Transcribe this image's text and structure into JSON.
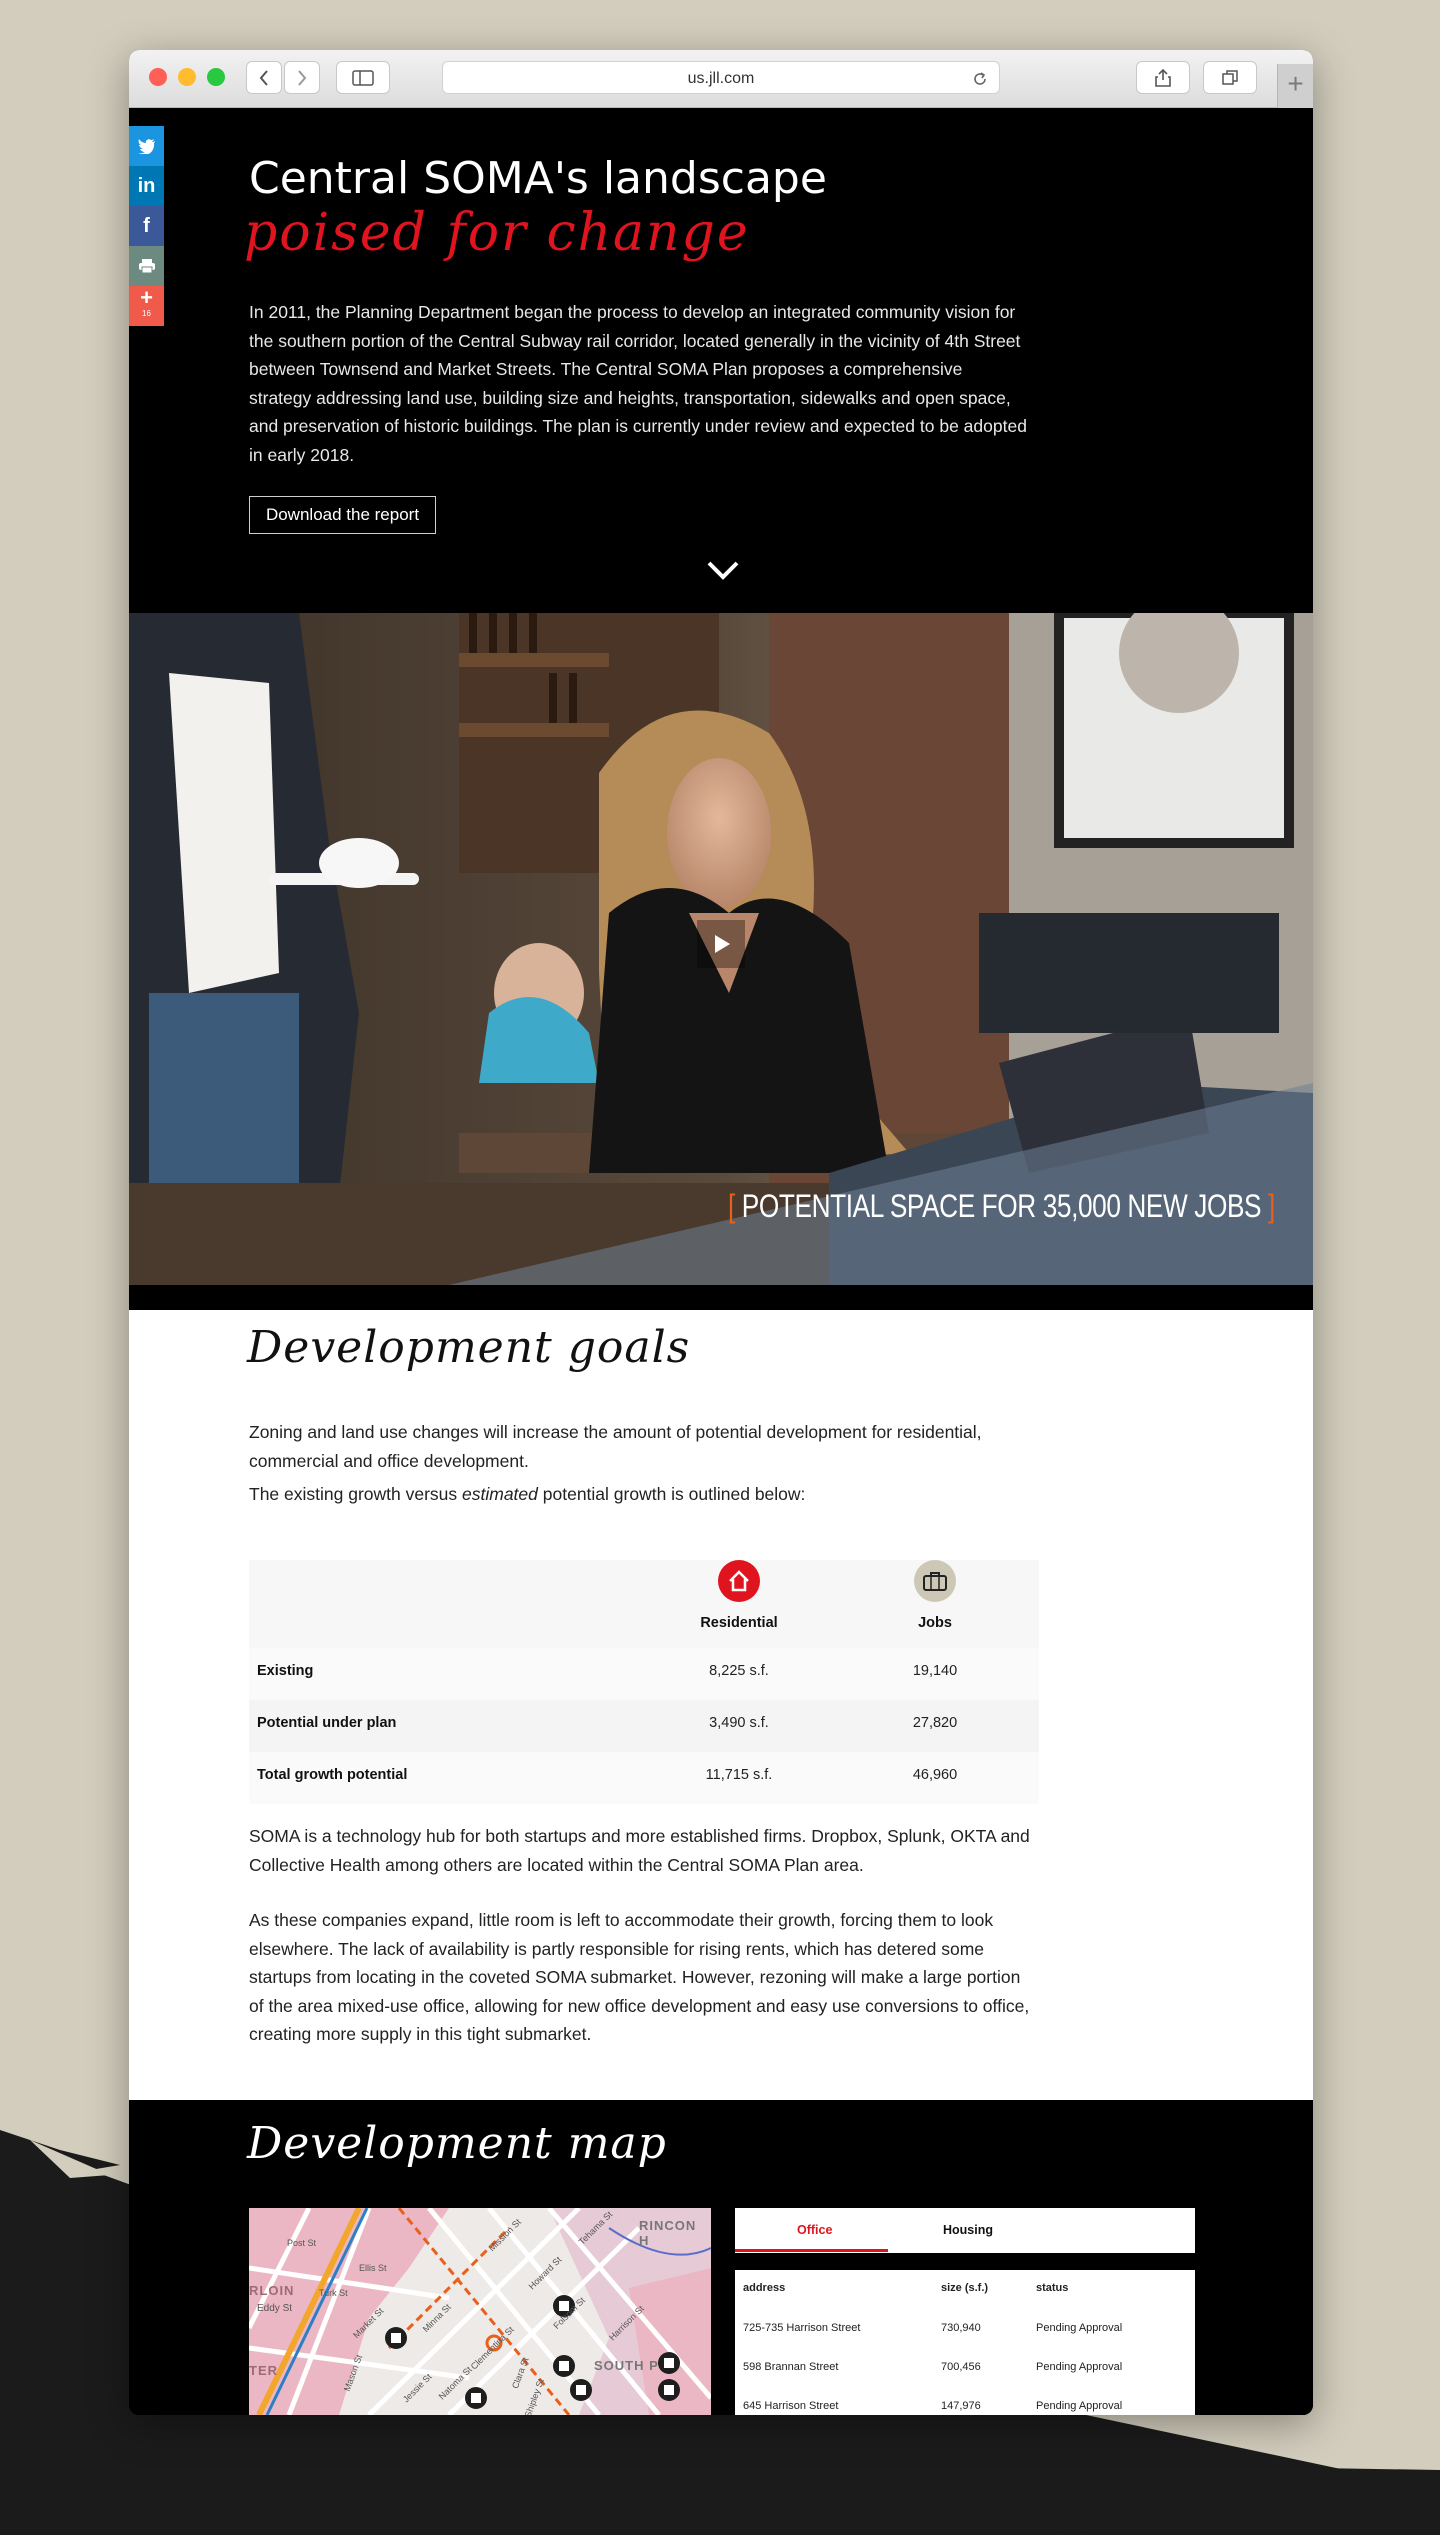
{
  "browser": {
    "url": "us.jll.com",
    "colors": {
      "close": "#fe5f57",
      "minimize": "#febc2e",
      "zoom": "#28c840"
    }
  },
  "social": {
    "items": [
      {
        "icon": "twitter-icon",
        "glyph": "🐦",
        "color": "#1b95e0"
      },
      {
        "icon": "linkedin-icon",
        "glyph": "in",
        "color": "#0077b5"
      },
      {
        "icon": "facebook-icon",
        "glyph": "f",
        "color": "#3b5998"
      },
      {
        "icon": "print-icon",
        "glyph": "⎙",
        "color": "#6d8a80"
      },
      {
        "icon": "more-icon",
        "glyph": "+",
        "color": "#f05a4a"
      }
    ],
    "share_count": "16"
  },
  "hero": {
    "title": "Central SOMA's landscape",
    "script": "poised for change",
    "body": "In 2011, the Planning Department began the process to develop an integrated community vision for the southern portion of the Central Subway rail corridor, located generally in the vicinity of 4th Street between Townsend and Market Streets. The Central SOMA Plan proposes a comprehensive strategy addressing land use, building size and heights, transportation, sidewalks and open space, and preservation of historic buildings. The plan is currently under review and expected to be adopted in early 2018.",
    "download_label": "Download the report"
  },
  "video": {
    "caption": "POTENTIAL SPACE FOR 35,000 NEW JOBS",
    "bracket_open": "[",
    "bracket_close": "]",
    "accent": "#e8601c"
  },
  "goals": {
    "heading": "Development goals",
    "intro": "Zoning and land use changes will increase the amount of potential development for residential, commercial and office development.",
    "outline_before": "The existing growth versus ",
    "outline_em": "estimated",
    "outline_after": " potential growth is outlined below:",
    "table": {
      "columns": [
        "Residential",
        "Jobs"
      ],
      "rows": [
        {
          "label": "Existing",
          "residential": "8,225 s.f.",
          "jobs": "19,140"
        },
        {
          "label": "Potential under plan",
          "residential": "3,490 s.f.",
          "jobs": "27,820"
        },
        {
          "label": "Total growth potential",
          "residential": "11,715 s.f.",
          "jobs": "46,960"
        }
      ],
      "residential_color": "#e0141f",
      "jobs_color": "#cdc8b6"
    },
    "p1": "SOMA is a technology hub for both startups and more established firms. Dropbox, Splunk, OKTA and Collective Health among others are located within the Central SOMA Plan area.",
    "p2": "As these companies expand, little room is left to accommodate their growth, forcing them to look elsewhere. The lack of availability is partly responsible for rising rents, which has detered some startups from locating in the coveted SOMA submarket. However, rezoning will make a large portion of the area mixed-use office, allowing for new office development and easy use conversions to office, creating more supply in this tight submarket."
  },
  "map": {
    "heading": "Development map",
    "labels": [
      "RINCON H",
      "RLOIN",
      "Eddy St",
      "TER",
      "SOUTH P",
      "Mission St",
      "Howard St",
      "Folsom St",
      "Market St",
      "Turk St",
      "Ellis St",
      "Mason St",
      "Minna St",
      "Natoma St",
      "Tehama St",
      "Post St",
      "Clara St",
      "Shipley St",
      "Harrison St",
      "Clementina St",
      "Jessie St"
    ],
    "tabs": [
      "Office",
      "Housing"
    ],
    "active_tab": "Office",
    "accent": "#e0141f",
    "table_headers": [
      "address",
      "size (s.f.)",
      "status"
    ],
    "rows": [
      {
        "address": "725-735 Harrison Street",
        "size": "730,940",
        "status": "Pending Approval"
      },
      {
        "address": "598 Brannan Street",
        "size": "700,456",
        "status": "Pending Approval"
      },
      {
        "address": "645 Harrison Street",
        "size": "147,976",
        "status": "Pending Approval"
      }
    ]
  }
}
